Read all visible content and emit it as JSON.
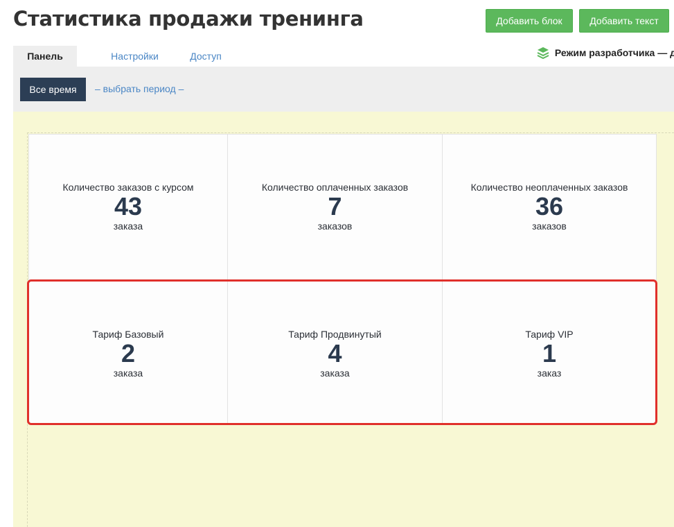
{
  "page": {
    "title": "Статистика продажи тренинга"
  },
  "toolbar": {
    "add_block_label": "Добавить блок",
    "add_text_label": "Добавить текст"
  },
  "tabs": [
    {
      "label": "Панель",
      "active": true
    },
    {
      "label": "Настройки",
      "active": false
    },
    {
      "label": "Доступ",
      "active": false
    }
  ],
  "dev_mode": {
    "label": "Режим разработчика — да",
    "icon": "layers-icon"
  },
  "filter": {
    "all_time_label": "Все время",
    "choose_period_label": "– выбрать период –"
  },
  "stats": [
    {
      "label": "Количество заказов с курсом",
      "value": "43",
      "unit": "заказа"
    },
    {
      "label": "Количество оплаченных заказов",
      "value": "7",
      "unit": "заказов"
    },
    {
      "label": "Количество неоплаченных заказов",
      "value": "36",
      "unit": "заказов"
    },
    {
      "label": "Тариф Базовый",
      "value": "2",
      "unit": "заказа"
    },
    {
      "label": "Тариф Продвинутый",
      "value": "4",
      "unit": "заказа"
    },
    {
      "label": "Тариф VIP",
      "value": "1",
      "unit": "заказ"
    }
  ],
  "colors": {
    "accent_green": "#5cb85c",
    "dark_button": "#2c3e55",
    "highlight_red": "#e0302b",
    "canvas_bg": "#f8f8d4",
    "link_blue": "#4a86c5"
  }
}
